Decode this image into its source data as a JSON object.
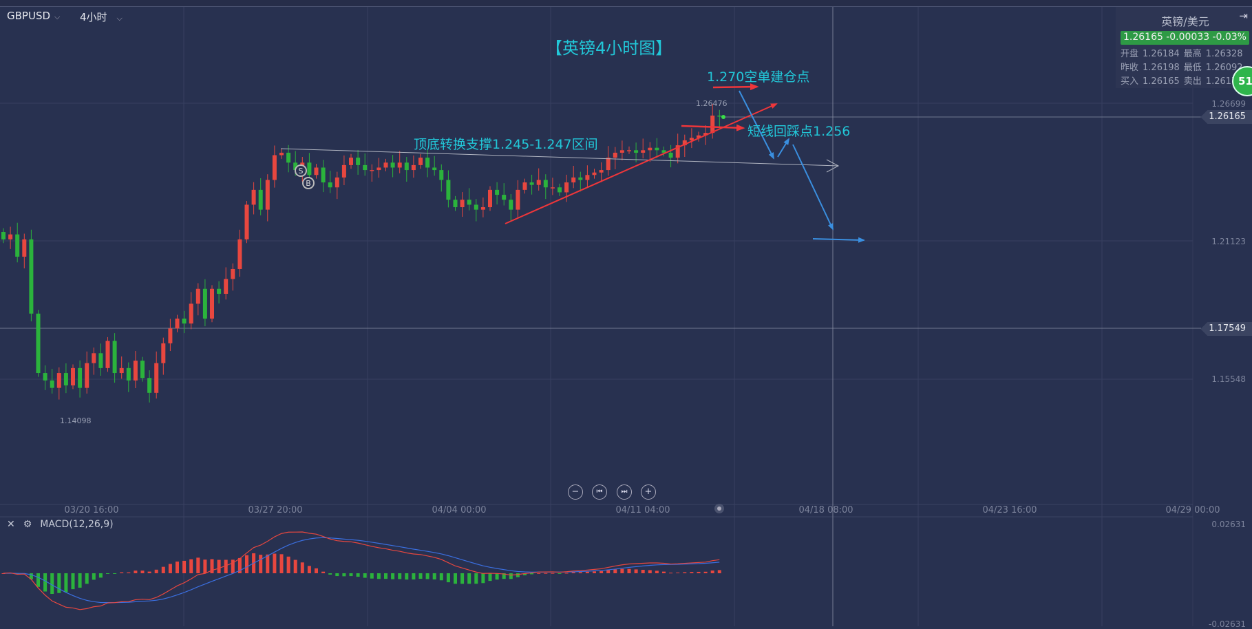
{
  "header": {
    "symbol": "GBPUSD",
    "timeframe": "4小时"
  },
  "chart_title": "【英镑4小时图】",
  "annotations": {
    "short_entry": "1.270空单建仓点",
    "support_zone": "顶底转换支撑1.245-1.247区间",
    "pullback": "短线回踩点1.256"
  },
  "price_axis": [
    "1.26699",
    "1.21123",
    "1.15548"
  ],
  "current_price_tag": "1.26165",
  "crosshair_price_tag": "1.17549",
  "high_label": "1.26476",
  "low_label": "1.14098",
  "markers": {
    "sell": "S",
    "buy": "B"
  },
  "time_axis": [
    "03/20 16:00",
    "03/27 20:00",
    "04/04 00:00",
    "04/11 04:00",
    "04/18 08:00",
    "04/23 16:00",
    "04/29 00:00"
  ],
  "zoom_controls": {
    "zoom_out": "−",
    "prev": "⏮",
    "next": "⏭",
    "zoom_in": "+"
  },
  "quote_panel": {
    "title": "英镑/美元",
    "last": "1.26165",
    "change": "-0.00033",
    "change_pct": "-0.03%",
    "rows": [
      [
        "开盘",
        "1.26184",
        "最高",
        "1.26328"
      ],
      [
        "昨收",
        "1.26198",
        "最低",
        "1.26092"
      ],
      [
        "买入",
        "1.26165",
        "卖出",
        "1.26173"
      ]
    ]
  },
  "badge": "51",
  "macd": {
    "label": "MACD(12,26,9)",
    "axis_top": "0.02631",
    "axis_bottom": "-0.02631"
  },
  "colors": {
    "up": "#e8473f",
    "down": "#2bb33c",
    "annotation": "#22c7d8",
    "arrow_red": "#f0363a",
    "arrow_blue": "#3a8fe0",
    "dif": "#e8473f",
    "dea": "#3b6fe0"
  },
  "chart_data": {
    "type": "candlestick",
    "price_range": [
      1.12,
      1.29
    ],
    "closes": [
      1.212,
      1.214,
      1.205,
      1.212,
      1.182,
      1.158,
      1.155,
      1.152,
      1.158,
      1.153,
      1.16,
      1.152,
      1.162,
      1.166,
      1.16,
      1.171,
      1.158,
      1.16,
      1.155,
      1.163,
      1.156,
      1.15,
      1.162,
      1.17,
      1.176,
      1.18,
      1.178,
      1.186,
      1.192,
      1.18,
      1.192,
      1.19,
      1.196,
      1.2,
      1.212,
      1.226,
      1.232,
      1.224,
      1.236,
      1.246,
      1.247,
      1.243,
      1.24,
      1.243,
      1.238,
      1.241,
      1.235,
      1.233,
      1.237,
      1.242,
      1.245,
      1.242,
      1.24,
      1.24,
      1.241,
      1.243,
      1.241,
      1.243,
      1.24,
      1.242,
      1.245,
      1.241,
      1.24,
      1.236,
      1.228,
      1.225,
      1.228,
      1.226,
      1.224,
      1.225,
      1.232,
      1.23,
      1.228,
      1.224,
      1.232,
      1.235,
      1.234,
      1.236,
      1.233,
      1.233,
      1.231,
      1.235,
      1.237,
      1.236,
      1.238,
      1.239,
      1.24,
      1.245,
      1.247,
      1.248,
      1.248,
      1.247,
      1.248,
      1.249,
      1.248,
      1.247,
      1.245,
      1.25,
      1.252,
      1.253,
      1.254,
      1.255,
      1.262,
      1.2617
    ]
  }
}
